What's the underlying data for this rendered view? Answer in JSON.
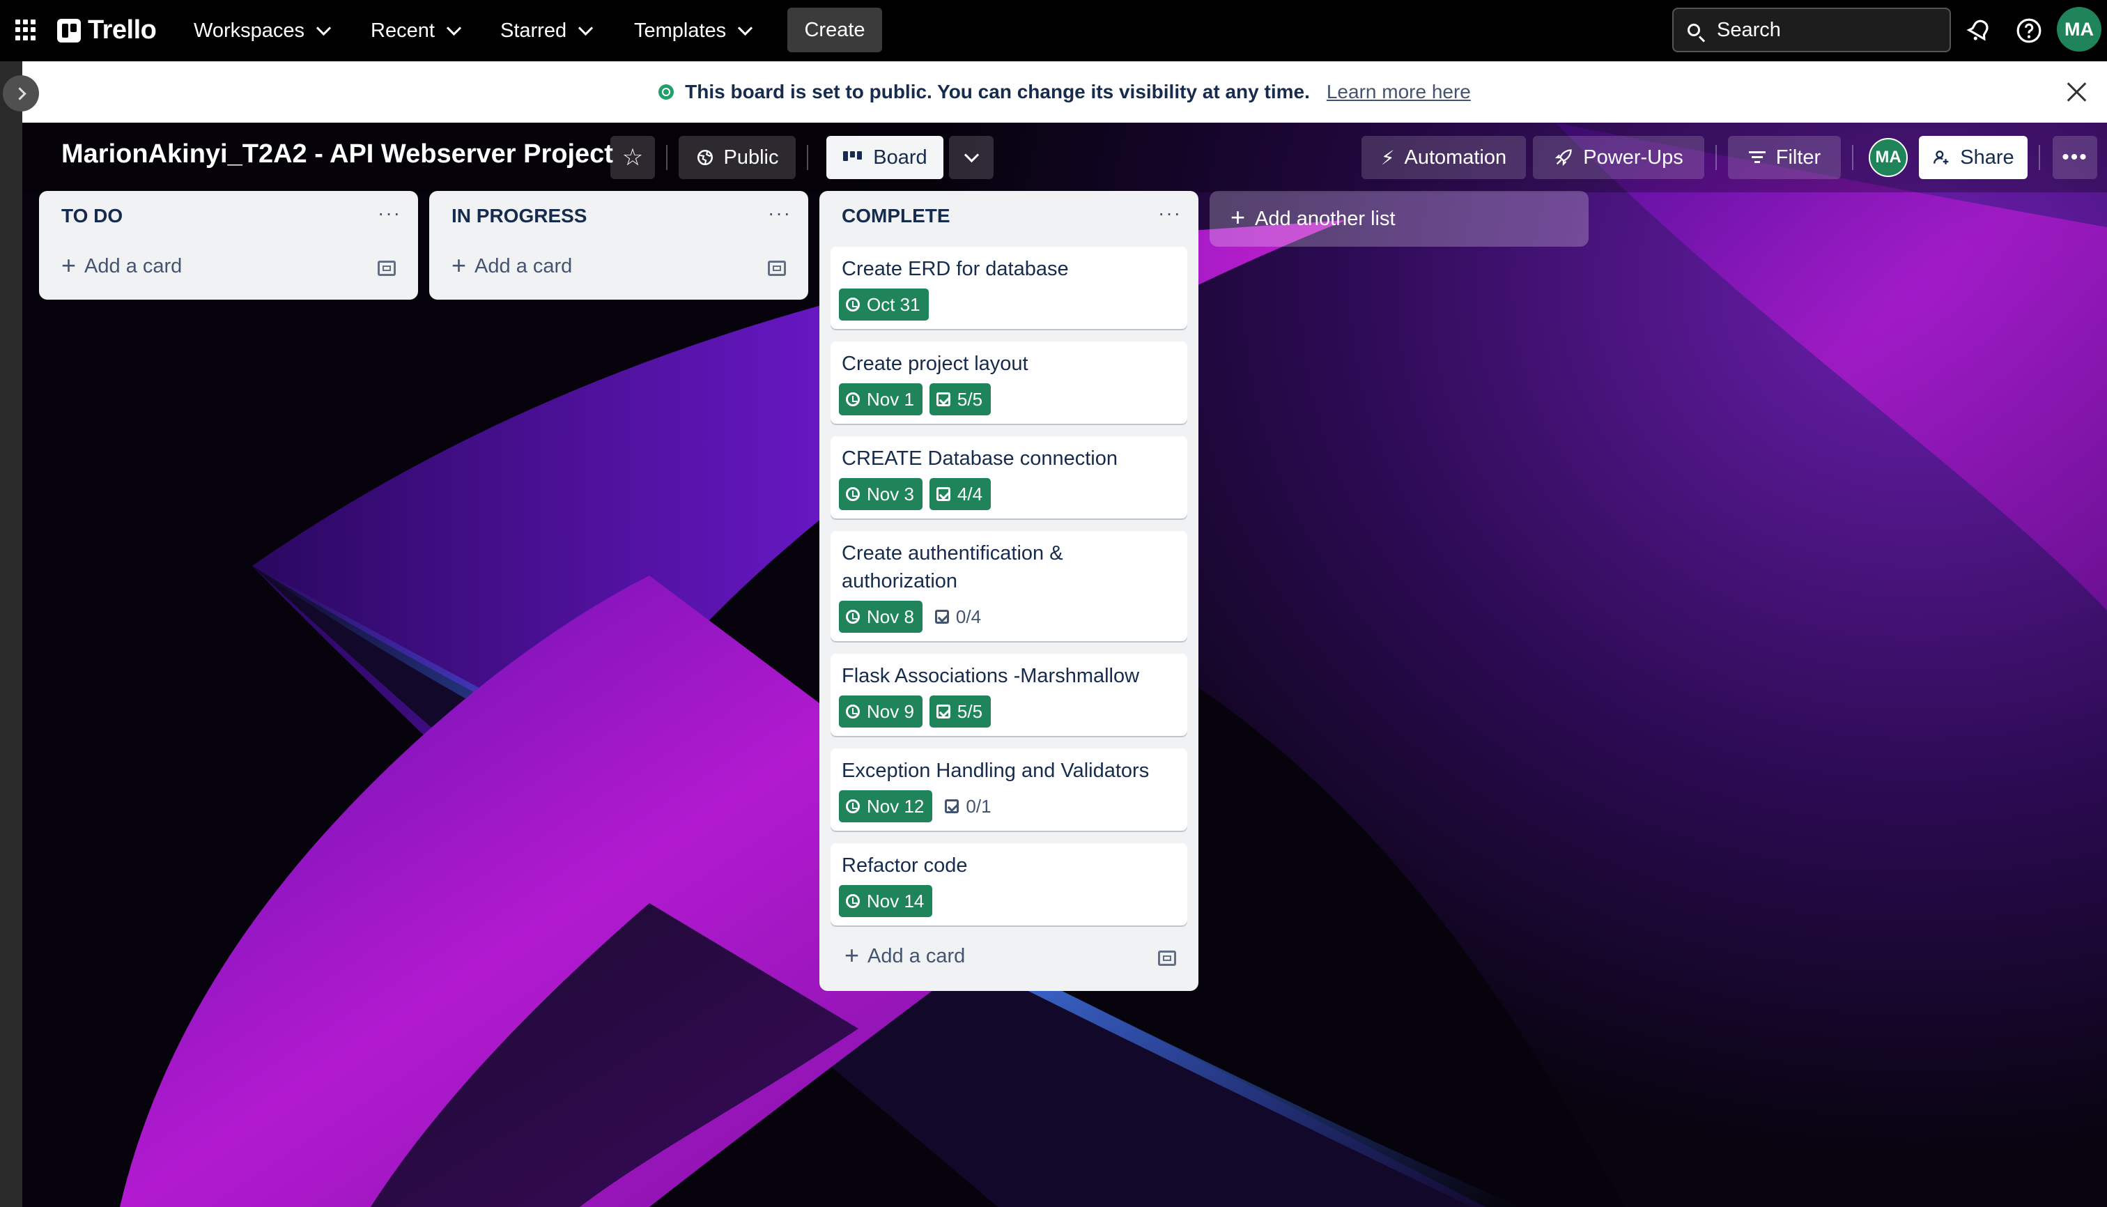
{
  "nav": {
    "logo": "Trello",
    "menus": [
      "Workspaces",
      "Recent",
      "Starred",
      "Templates"
    ],
    "create": "Create",
    "search_placeholder": "Search",
    "avatar": "MA"
  },
  "banner": {
    "text": "This board is set to public. You can change its visibility at any time.",
    "link": "Learn more here"
  },
  "board": {
    "title": "MarionAkinyi_T2A2 - API Webserver Project",
    "visibility": "Public",
    "view": "Board",
    "automation": "Automation",
    "powerups": "Power-Ups",
    "filter": "Filter",
    "member_avatar": "MA",
    "share": "Share"
  },
  "lists": [
    {
      "title": "TO DO",
      "menu": "···",
      "add_card": "Add a card"
    },
    {
      "title": "IN PROGRESS",
      "menu": "···",
      "add_card": "Add a card"
    },
    {
      "title": "COMPLETE",
      "menu": "···",
      "add_card": "Add a card",
      "cards": [
        {
          "title": "Create ERD for database",
          "due": "Oct 31",
          "checklist": "",
          "checklist_complete": false
        },
        {
          "title": "Create project layout",
          "due": "Nov 1",
          "checklist": "5/5",
          "checklist_complete": true
        },
        {
          "title": "CREATE Database connection",
          "due": "Nov 3",
          "checklist": "4/4",
          "checklist_complete": true
        },
        {
          "title": "Create authentification & authorization",
          "due": "Nov 8",
          "checklist": "0/4",
          "checklist_complete": false
        },
        {
          "title": "Flask Associations -Marshmallow",
          "due": "Nov 9",
          "checklist": "5/5",
          "checklist_complete": true
        },
        {
          "title": "Exception Handling and Validators",
          "due": "Nov 12",
          "checklist": "0/1",
          "checklist_complete": false
        },
        {
          "title": "Refactor code",
          "due": "Nov 14",
          "checklist": "",
          "checklist_complete": false
        }
      ]
    }
  ],
  "add_list": "Add another list",
  "colors": {
    "due_green": "#1f845a",
    "avatar_green": "#1f845a",
    "list_bg": "#f1f2f4",
    "background_accent": "#b218c8",
    "background_blue": "#3a6cff"
  }
}
